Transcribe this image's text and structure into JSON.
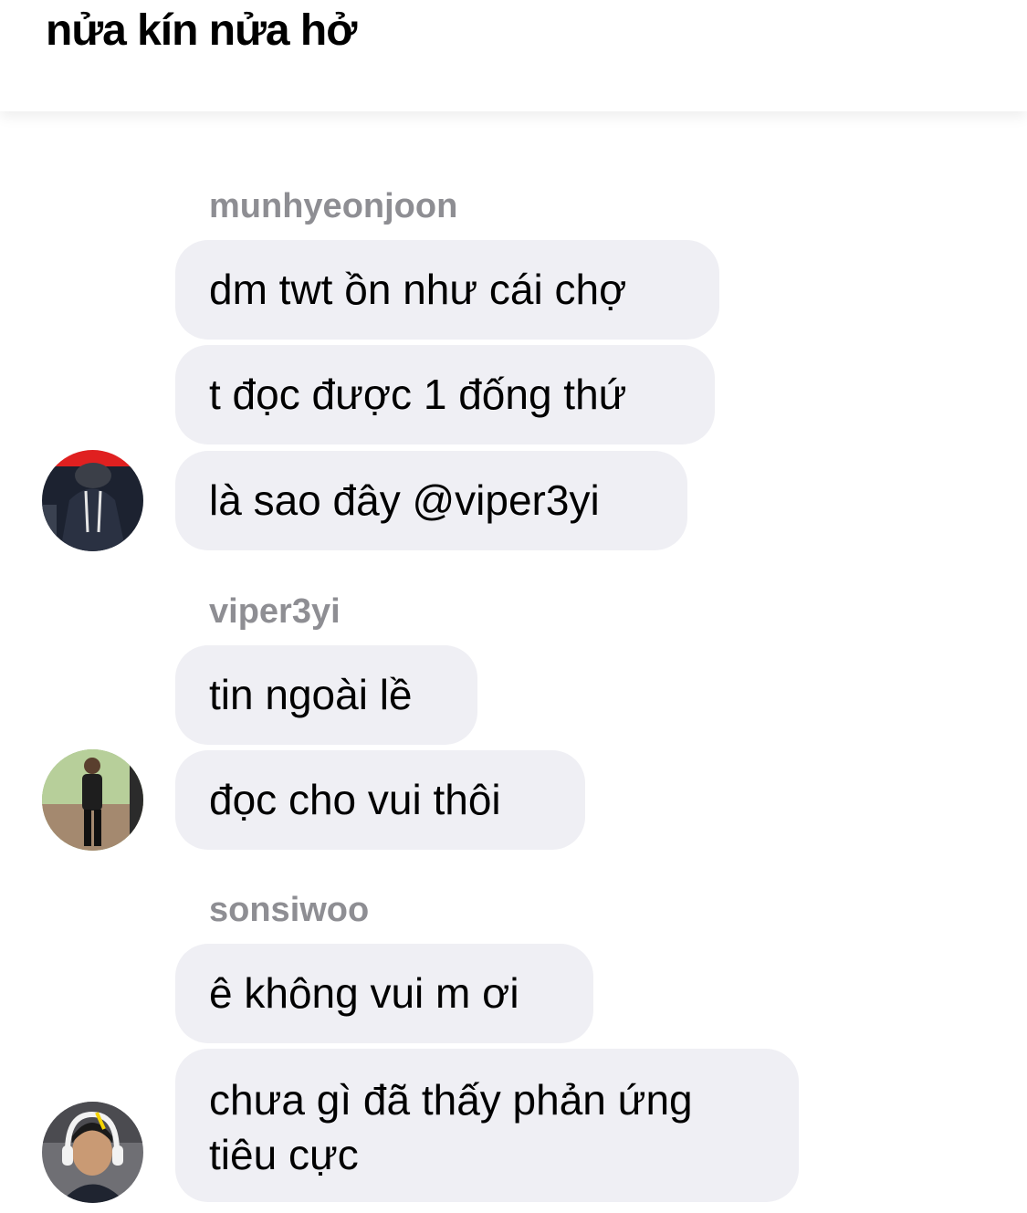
{
  "header": {
    "title": "nửa kín nửa hở"
  },
  "groups": [
    {
      "sender": "munhyeonjoon",
      "avatar_icon": "person-hoodie-avatar-icon",
      "messages": [
        "dm twt ồn như cái chợ",
        "t đọc được 1 đống thứ",
        "là sao đây @viper3yi"
      ]
    },
    {
      "sender": "viper3yi",
      "avatar_icon": "person-standing-avatar-icon",
      "messages": [
        "tin ngoài lề",
        "đọc cho vui thôi"
      ]
    },
    {
      "sender": "sonsiwoo",
      "avatar_icon": "person-headset-avatar-icon",
      "messages": [
        "ê không vui m ơi",
        "chưa gì đã thấy phản ứng tiêu cực"
      ]
    }
  ],
  "colors": {
    "bubble": "#efeff4",
    "sender_label": "#8e8e93",
    "text": "#000000"
  }
}
